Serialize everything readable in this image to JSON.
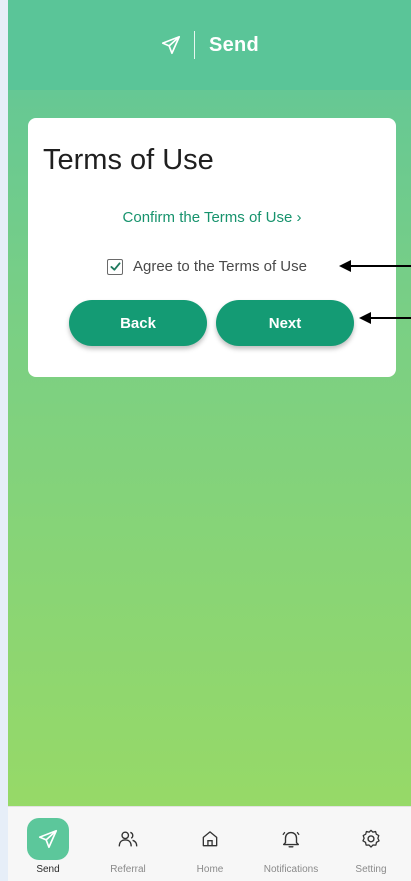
{
  "header": {
    "title": "Send",
    "icon": "send-icon"
  },
  "card": {
    "heading": "Terms of Use",
    "terms_link": "Confirm the Terms of Use",
    "agree_label": "Agree to the Terms of Use",
    "agree_checked": true,
    "back_label": "Back",
    "next_label": "Next"
  },
  "tabs": [
    {
      "label": "Send",
      "icon": "send-icon",
      "active": true
    },
    {
      "label": "Referral",
      "icon": "people-icon",
      "active": false
    },
    {
      "label": "Home",
      "icon": "home-icon",
      "active": false
    },
    {
      "label": "Notifications",
      "icon": "bell-icon",
      "active": false
    },
    {
      "label": "Setting",
      "icon": "gear-icon",
      "active": false
    }
  ],
  "colors": {
    "header": "#5ac598",
    "button": "#149b74",
    "link": "#17936d",
    "gradient_top": "#5ec59a",
    "gradient_bottom": "#9bdb63"
  }
}
